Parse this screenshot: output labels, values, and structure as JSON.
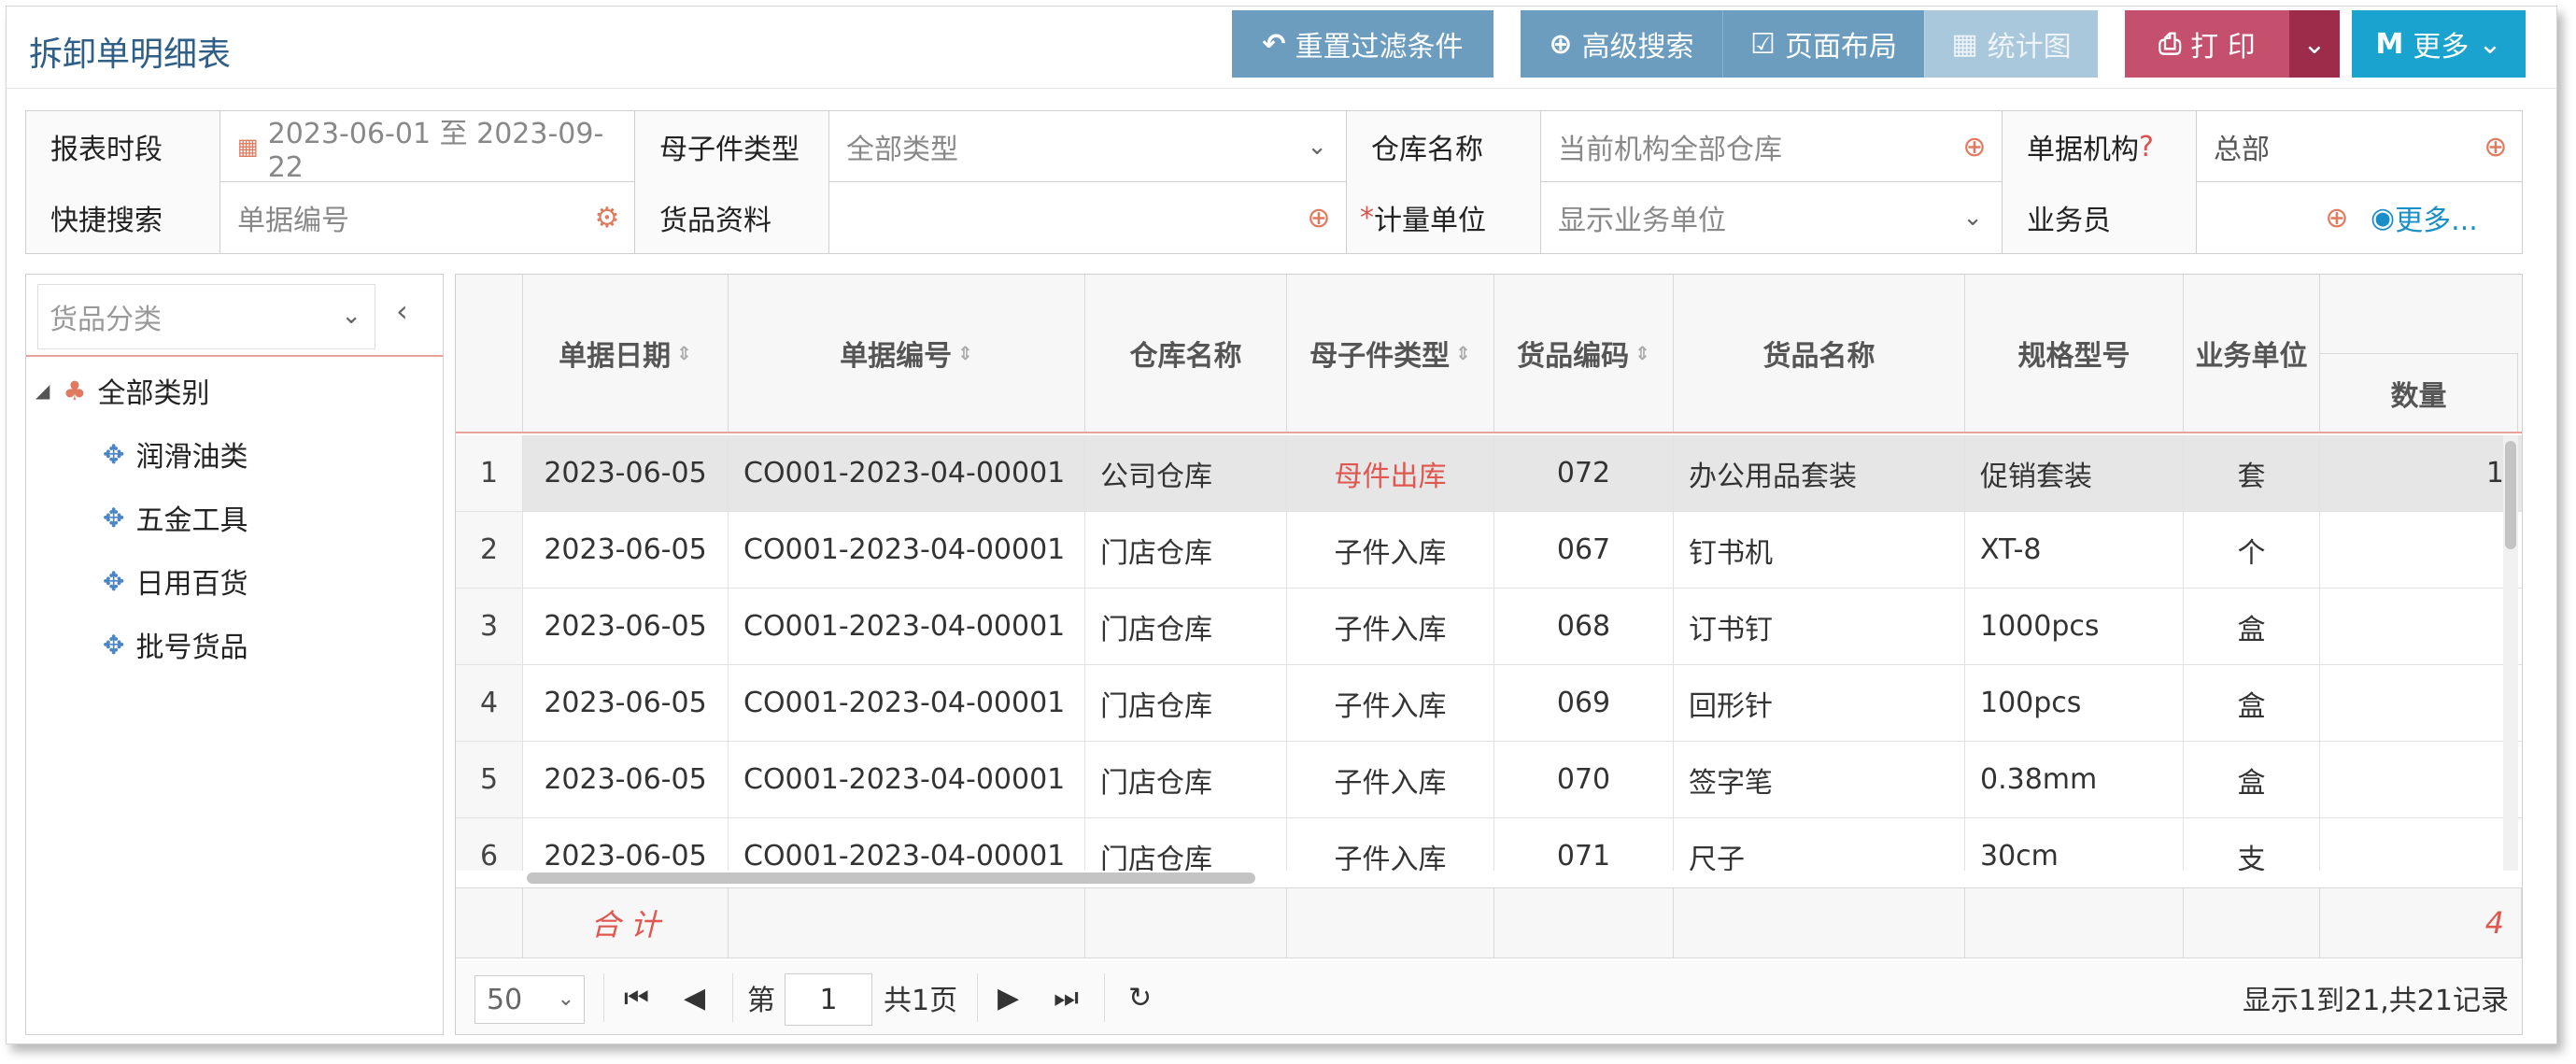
{
  "header": {
    "title": "拆卸单明细表",
    "buttons": {
      "reset_filters": "重置过滤条件",
      "advanced_search": "高级搜索",
      "page_layout": "页面布局",
      "statistics_chart": "统计图",
      "print": "打 印",
      "more": "更多"
    }
  },
  "filters": {
    "report_period": {
      "label": "报表时段",
      "value": "2023-06-01 至 2023-09-22"
    },
    "parent_child_type": {
      "label": "母子件类型",
      "value": "全部类型"
    },
    "warehouse": {
      "label": "仓库名称",
      "placeholder": "当前机构全部仓库"
    },
    "org": {
      "label": "单据机构",
      "qmark": "?",
      "value": "总部"
    },
    "quick_search": {
      "label": "快捷搜索",
      "placeholder": "单据编号"
    },
    "goods": {
      "label": "货品资料",
      "value": ""
    },
    "unit": {
      "required_mark": "*",
      "label": "计量单位",
      "value": "显示业务单位"
    },
    "salesperson": {
      "label": "业务员",
      "value": ""
    },
    "more_link": "更多..."
  },
  "tree": {
    "select_placeholder": "货品分类",
    "root": "全部类别",
    "items": [
      "润滑油类",
      "五金工具",
      "日用百货",
      "批号货品"
    ]
  },
  "grid": {
    "columns": {
      "date": "单据日期",
      "doc_no": "单据编号",
      "warehouse": "仓库名称",
      "pc_type": "母子件类型",
      "goods_code": "货品编码",
      "goods_name": "货品名称",
      "spec": "规格型号",
      "unit": "业务单位",
      "qty": "数量"
    },
    "rows": [
      {
        "num": "1",
        "date": "2023-06-05",
        "doc_no": "CO001-2023-04-00001",
        "warehouse": "公司仓库",
        "pc_type": "母件出库",
        "goods_code": "072",
        "goods_name": "办公用品套装",
        "spec": "促销套装",
        "unit": "套",
        "qty": "1"
      },
      {
        "num": "2",
        "date": "2023-06-05",
        "doc_no": "CO001-2023-04-00001",
        "warehouse": "门店仓库",
        "pc_type": "子件入库",
        "goods_code": "067",
        "goods_name": "钉书机",
        "spec": "XT-8",
        "unit": "个",
        "qty": ""
      },
      {
        "num": "3",
        "date": "2023-06-05",
        "doc_no": "CO001-2023-04-00001",
        "warehouse": "门店仓库",
        "pc_type": "子件入库",
        "goods_code": "068",
        "goods_name": "订书钉",
        "spec": "1000pcs",
        "unit": "盒",
        "qty": ""
      },
      {
        "num": "4",
        "date": "2023-06-05",
        "doc_no": "CO001-2023-04-00001",
        "warehouse": "门店仓库",
        "pc_type": "子件入库",
        "goods_code": "069",
        "goods_name": "回形针",
        "spec": "100pcs",
        "unit": "盒",
        "qty": ""
      },
      {
        "num": "5",
        "date": "2023-06-05",
        "doc_no": "CO001-2023-04-00001",
        "warehouse": "门店仓库",
        "pc_type": "子件入库",
        "goods_code": "070",
        "goods_name": "签字笔",
        "spec": "0.38mm",
        "unit": "盒",
        "qty": ""
      },
      {
        "num": "6",
        "date": "2023-06-05",
        "doc_no": "CO001-2023-04-00001",
        "warehouse": "门店仓库",
        "pc_type": "子件入库",
        "goods_code": "071",
        "goods_name": "尺子",
        "spec": "30cm",
        "unit": "支",
        "qty": ""
      }
    ],
    "footer": {
      "label": "合 计",
      "qty_total": "4"
    }
  },
  "pager": {
    "page_size": "50",
    "page_prefix": "第",
    "page_current": "1",
    "page_total": "共1页",
    "summary": "显示1到21,共21记录"
  },
  "colors": {
    "title": "#2f5f86",
    "button_blue": "#6c9dbf",
    "button_print": "#c5506d",
    "button_more": "#1aa3cf",
    "accent_red": "#e0574f"
  }
}
